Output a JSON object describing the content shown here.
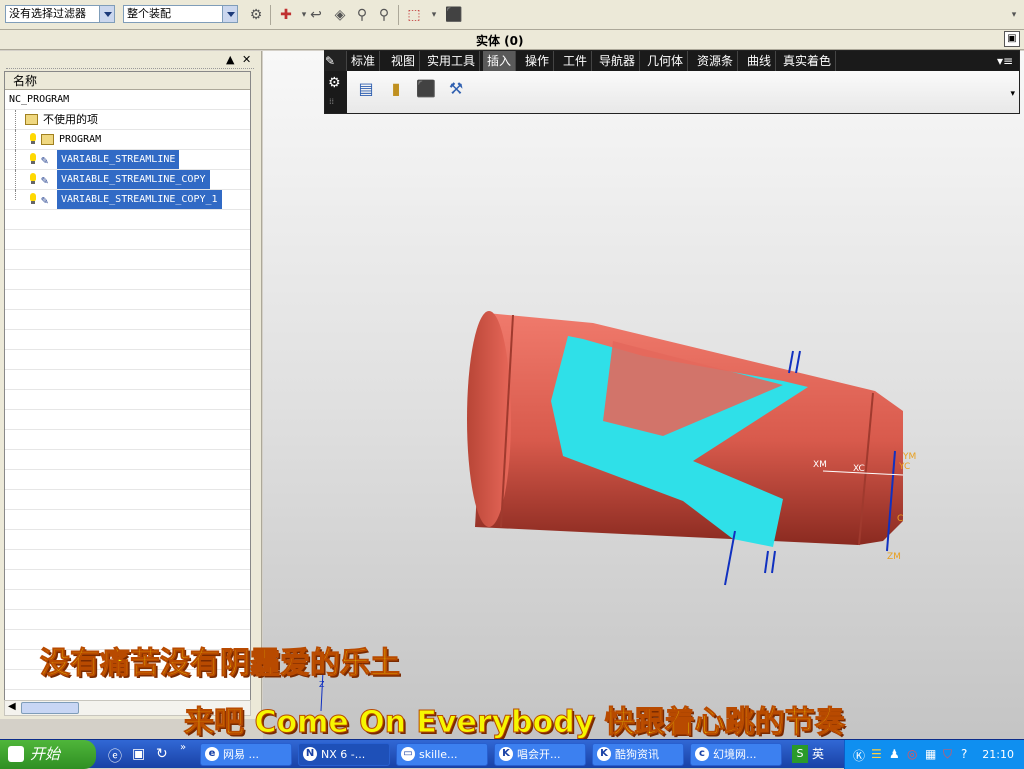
{
  "toolbar": {
    "type_filter": "没有选择过滤器",
    "assembly_scope": "整个装配"
  },
  "section": {
    "title": "实体 (0)"
  },
  "navigator": {
    "column_header": "名称",
    "rows": [
      {
        "label": "NC_PROGRAM"
      },
      {
        "label": "不使用的项"
      },
      {
        "label": "PROGRAM"
      },
      {
        "label": "VARIABLE_STREAMLINE"
      },
      {
        "label": "VARIABLE_STREAMLINE_COPY"
      },
      {
        "label": "VARIABLE_STREAMLINE_COPY_1"
      }
    ]
  },
  "ribbon": {
    "tabs": [
      "标准",
      "视图",
      "实用工具",
      "插入",
      "操作",
      "工件",
      "导航器",
      "几何体",
      "资源条",
      "曲线",
      "真实着色"
    ],
    "active_tab": "插入"
  },
  "viewport": {
    "wcs_labels": [
      "XM",
      "XC",
      "YM",
      "YC",
      "C",
      "ZM",
      "Z"
    ]
  },
  "lyrics": {
    "line1": "没有痛苦没有阴霾爱的乐土",
    "line2": "来吧 Come On Everybody 快跟着心跳的节奏"
  },
  "taskbar": {
    "start_label": "开始",
    "items": [
      "网易 ...",
      "NX 6 -...",
      "skille...",
      "唱会开...",
      "酷狗资讯",
      "幻境网..."
    ],
    "ime": "英",
    "clock": "21:10"
  },
  "colors": {
    "part": "#e8685a",
    "toolpath": "#2fe0e8",
    "selection": "#316ac5",
    "taskbar": "#245edb"
  }
}
